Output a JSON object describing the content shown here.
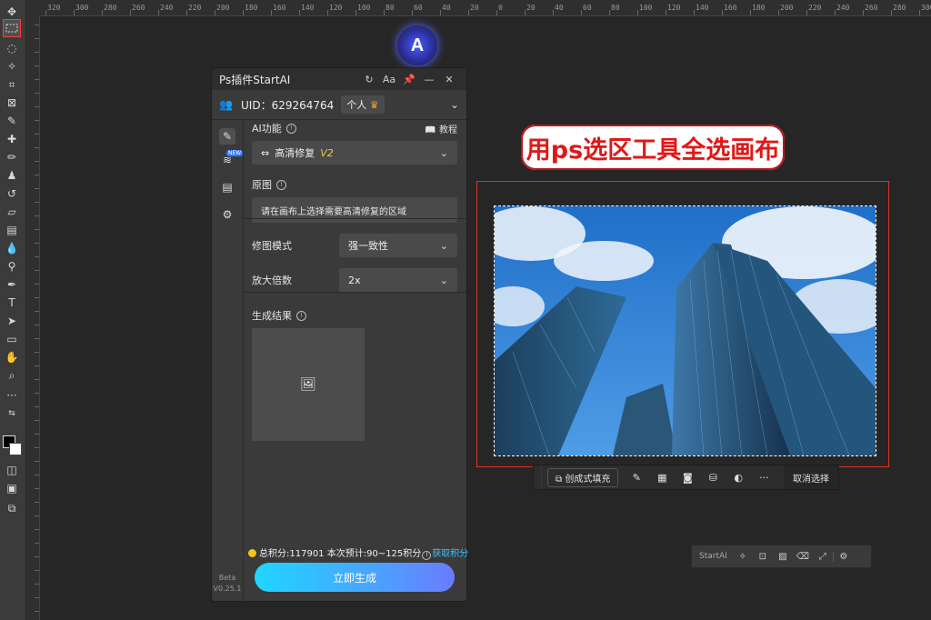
{
  "ruler": {
    "ticks": [
      "320",
      "300",
      "280",
      "260",
      "240",
      "220",
      "200",
      "180",
      "160",
      "140",
      "120",
      "100",
      "80",
      "60",
      "40",
      "20",
      "0",
      "20",
      "40",
      "60",
      "80",
      "100",
      "120",
      "140",
      "160",
      "180",
      "200",
      "220",
      "240",
      "260",
      "280",
      "300"
    ]
  },
  "plugin": {
    "title": "Ps插件StartAI",
    "header_icons": [
      "refresh-icon",
      "font-size-icon",
      "pin-icon",
      "minimize-icon",
      "close-icon"
    ],
    "font_icon_label": "Aa",
    "uid": "UID：629264764",
    "account_badge": "个人",
    "ai_function_label": "AI功能",
    "tutorial_label": "教程",
    "function_value": "高清修复",
    "function_version": "V2",
    "original_label": "原图",
    "original_tip": "请在画布上选择需要高清修复的区域",
    "mode_label": "修图模式",
    "mode_value": "强一致性",
    "scale_label": "放大倍数",
    "scale_value": "2x",
    "result_label": "生成结果",
    "points_text": "总积分:117901 本次预计:90~125积分",
    "get_points": "获取积分",
    "generate_button": "立即生成",
    "new_badge": "NEW",
    "version_line1": "Beta",
    "version_line2": "V0.25.1"
  },
  "callout": "用ps选区工具全选画布",
  "context_bar": {
    "generative_fill": "创成式填充",
    "deselect": "取消选择",
    "more": "···"
  },
  "minibar": {
    "name": "StartAI"
  },
  "colors": {
    "accent_red": "#d9341f",
    "callout_text": "#e01818",
    "generate_gradient_start": "#1fd6ff",
    "generate_gradient_end": "#6b7bff",
    "points_link": "#36c6ff"
  }
}
